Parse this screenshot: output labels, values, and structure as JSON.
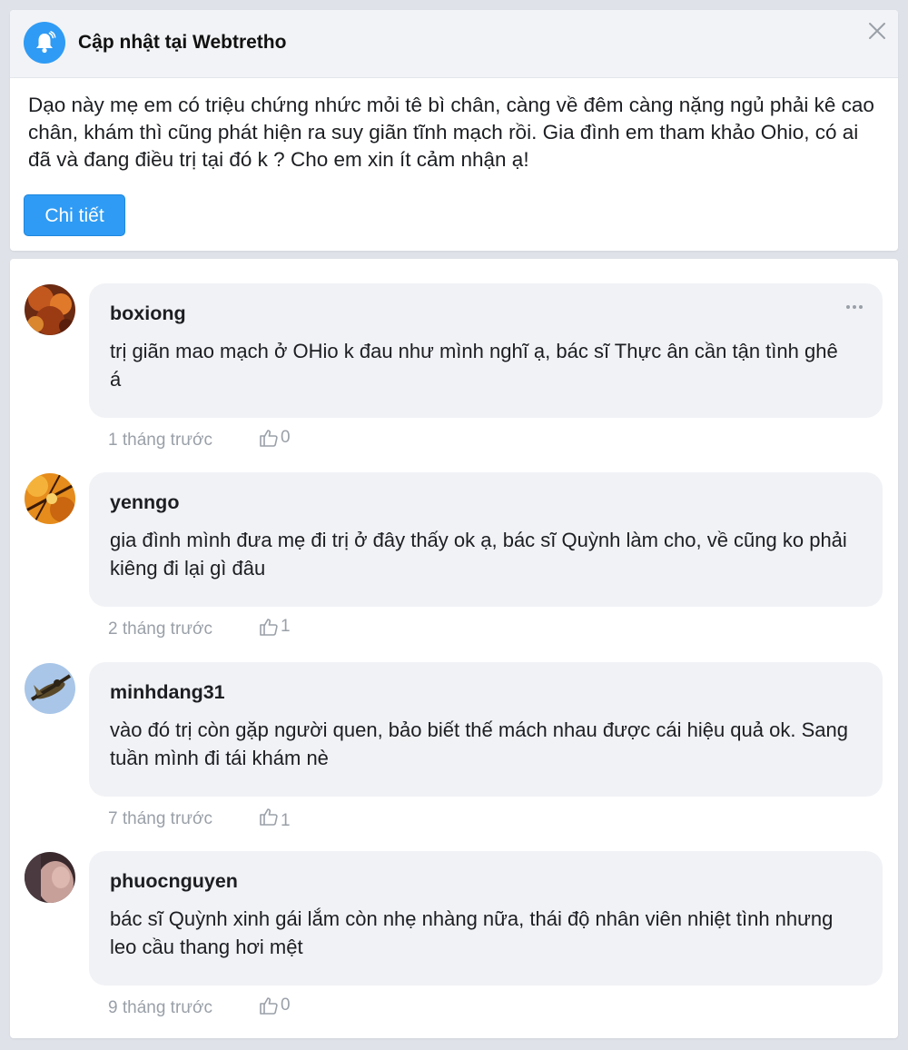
{
  "notification": {
    "title": "Cập nhật tại Webtretho",
    "icon": "bell-icon",
    "body": "Dạo này mẹ em có triệu chứng nhức mỏi tê bì chân, càng về đêm càng nặng ngủ phải kê cao chân, khám thì cũng phát hiện ra suy giãn tĩnh mạch rồi. Gia đình em tham khảo Ohio, có ai đã và đang điều trị tại đó k ? Cho em xin ít cảm nhận ạ!",
    "detail_label": "Chi tiết",
    "accent": "#2f9bf4"
  },
  "comments": [
    {
      "username": "boxiong",
      "text": "trị giãn mao mạch ở OHio k đau như mình nghĩ ạ, bác sĩ Thực ân cần tận tình ghê á",
      "time": "1 tháng trước",
      "likes": "0"
    },
    {
      "username": "yenngo",
      "text": "gia đình mình đưa mẹ đi trị ở đây thấy ok ạ, bác sĩ Quỳnh làm cho, về cũng ko phải kiêng đi lại gì đâu",
      "time": "2 tháng trước",
      "likes": "1"
    },
    {
      "username": "minhdang31",
      "text": "vào đó trị còn gặp người quen, bảo biết thế mách nhau được cái hiệu quả ok. Sang tuần mình đi tái khám nè",
      "time": "7 tháng trước",
      "likes": "1"
    },
    {
      "username": "phuocnguyen",
      "text": "bác sĩ Quỳnh xinh gái lắm còn nhẹ nhàng nữa, thái độ nhân viên nhiệt tình nhưng leo cầu thang hơi mệt",
      "time": "9 tháng trước",
      "likes": "0"
    }
  ]
}
